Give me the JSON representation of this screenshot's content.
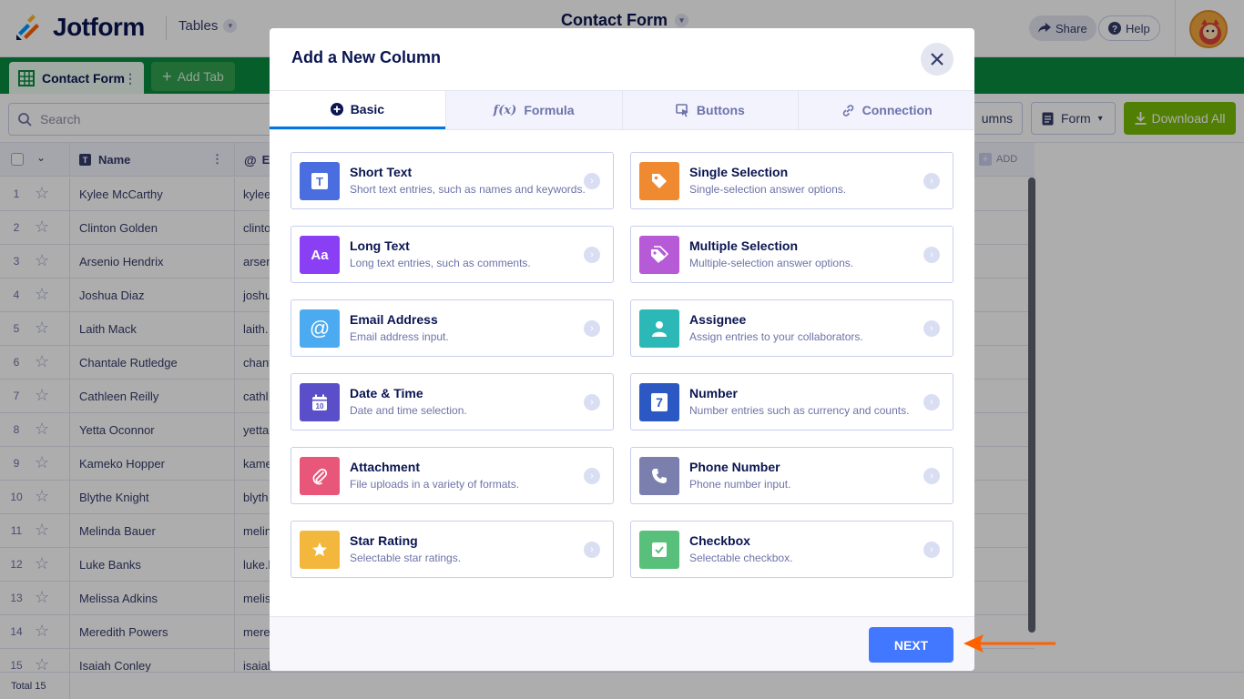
{
  "header": {
    "logo_text": "Jotform",
    "tables_label": "Tables",
    "form_title": "Contact Form",
    "share_label": "Share",
    "help_label": "Help"
  },
  "tabs_bar": {
    "active_tab": "Contact Form",
    "add_tab_label": "Add Tab"
  },
  "toolbar": {
    "search_placeholder": "Search",
    "columns_label": "umns",
    "form_label": "Form",
    "download_label": "Download All"
  },
  "grid": {
    "columns": [
      {
        "label": "Name",
        "icon": "text-type-icon"
      },
      {
        "label": "E",
        "icon": "at-icon"
      }
    ],
    "add_column_label": "ADD",
    "rows": [
      {
        "num": "1",
        "name": "Kylee McCarthy",
        "email": "kylee"
      },
      {
        "num": "2",
        "name": "Clinton Golden",
        "email": "clinto"
      },
      {
        "num": "3",
        "name": "Arsenio Hendrix",
        "email": "arser"
      },
      {
        "num": "4",
        "name": "Joshua Diaz",
        "email": "joshu"
      },
      {
        "num": "5",
        "name": "Laith Mack",
        "email": "laith."
      },
      {
        "num": "6",
        "name": "Chantale Rutledge",
        "email": "chant"
      },
      {
        "num": "7",
        "name": "Cathleen Reilly",
        "email": "cathl"
      },
      {
        "num": "8",
        "name": "Yetta Oconnor",
        "email": "yetta"
      },
      {
        "num": "9",
        "name": "Kameko Hopper",
        "email": "kame"
      },
      {
        "num": "10",
        "name": "Blythe Knight",
        "email": "blyth"
      },
      {
        "num": "11",
        "name": "Melinda Bauer",
        "email": "melin"
      },
      {
        "num": "12",
        "name": "Luke Banks",
        "email": "luke.l"
      },
      {
        "num": "13",
        "name": "Melissa Adkins",
        "email": "melis"
      },
      {
        "num": "14",
        "name": "Meredith Powers",
        "email": "mere"
      },
      {
        "num": "15",
        "name": "Isaiah Conley",
        "email": "isaiah"
      }
    ],
    "footer_total": "Total 15"
  },
  "modal": {
    "title": "Add a New Column",
    "tabs": [
      {
        "label": "Basic",
        "icon": "plus-circle-icon",
        "active": true
      },
      {
        "label": "Formula",
        "icon": "function-icon",
        "active": false
      },
      {
        "label": "Buttons",
        "icon": "cursor-button-icon",
        "active": false
      },
      {
        "label": "Connection",
        "icon": "link-icon",
        "active": false
      }
    ],
    "column_types": [
      {
        "title": "Short Text",
        "desc": "Short text entries, such as names and keywords.",
        "icon": "short-text-icon",
        "color": "#4a6ee0"
      },
      {
        "title": "Single Selection",
        "desc": "Single-selection answer options.",
        "icon": "tag-icon",
        "color": "#f08a30"
      },
      {
        "title": "Long Text",
        "desc": "Long text entries, such as comments.",
        "icon": "long-text-icon",
        "color": "#8b3ff5"
      },
      {
        "title": "Multiple Selection",
        "desc": "Multiple-selection answer options.",
        "icon": "tags-icon",
        "color": "#b65ad8"
      },
      {
        "title": "Email Address",
        "desc": "Email address input.",
        "icon": "at-icon",
        "color": "#4cabf0"
      },
      {
        "title": "Assignee",
        "desc": "Assign entries to your collaborators.",
        "icon": "person-icon",
        "color": "#2db8b8"
      },
      {
        "title": "Date & Time",
        "desc": "Date and time selection.",
        "icon": "calendar-icon",
        "color": "#5a4fc8"
      },
      {
        "title": "Number",
        "desc": "Number entries such as currency and counts.",
        "icon": "number-icon",
        "color": "#2c58c4"
      },
      {
        "title": "Attachment",
        "desc": "File uploads in a variety of formats.",
        "icon": "paperclip-icon",
        "color": "#e8567a"
      },
      {
        "title": "Phone Number",
        "desc": "Phone number input.",
        "icon": "phone-icon",
        "color": "#7b7fae"
      },
      {
        "title": "Star Rating",
        "desc": "Selectable star ratings.",
        "icon": "star-icon",
        "color": "#f2b73c"
      },
      {
        "title": "Checkbox",
        "desc": "Selectable checkbox.",
        "icon": "checkbox-icon",
        "color": "#58c07a"
      }
    ],
    "next_label": "NEXT"
  },
  "colors": {
    "brand_green": "#0a8c3e",
    "download_green": "#78bb07",
    "next_blue": "#4277ff",
    "annotation_orange": "#ff6100"
  }
}
